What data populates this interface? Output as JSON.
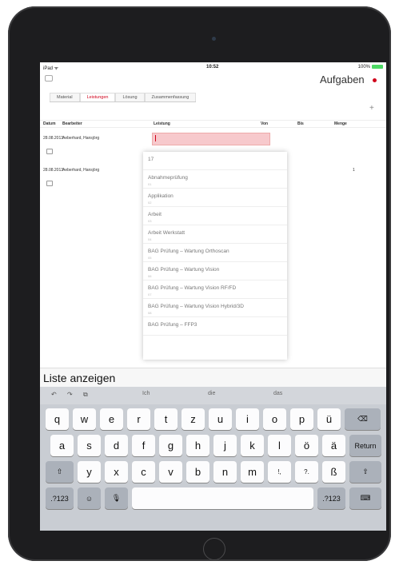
{
  "status": {
    "left": "iPad ᯤ",
    "time": "10:52",
    "battery": "100%"
  },
  "nav": {
    "title": "Aufgaben"
  },
  "tabs": [
    "Material",
    "Leistungen",
    "Lösung",
    "Zusammenfassung"
  ],
  "table": {
    "headers": [
      "Datum",
      "Bearbeiter",
      "Leistung",
      "Von",
      "Bis",
      "Menge"
    ],
    "rows": [
      {
        "date": "28.08.2013",
        "person": "Aeberhard, Hansjörg",
        "menge": ""
      },
      {
        "date": "28.08.2013",
        "person": "Aeberhard, Hansjörg",
        "menge": "1"
      }
    ]
  },
  "dropdown": {
    "items": [
      {
        "label": "17",
        "sub": ""
      },
      {
        "label": "Abnahmeprüfung",
        "sub": "01"
      },
      {
        "label": "Applikation",
        "sub": "02"
      },
      {
        "label": "Arbeit",
        "sub": "03"
      },
      {
        "label": "Arbeit Werkstatt",
        "sub": "04"
      },
      {
        "label": "BAG Prüfung – Wartung Orthoscan",
        "sub": "05"
      },
      {
        "label": "BAG Prüfung – Wartung Vision",
        "sub": "06"
      },
      {
        "label": "BAG Prüfung – Wartung Vision RF/FD",
        "sub": "07"
      },
      {
        "label": "BAG Prüfung – Wartung Vision Hybrid/3D",
        "sub": "08"
      },
      {
        "label": "BAG Prüfung – FFP3",
        "sub": ""
      }
    ]
  },
  "suggestion": "Liste anzeigen",
  "keyboard": {
    "tools": [
      "↶",
      "↷",
      "⧉"
    ],
    "predictions": [
      "Ich",
      "die",
      "das"
    ],
    "row1": [
      "q",
      "w",
      "e",
      "r",
      "t",
      "z",
      "u",
      "i",
      "o",
      "p",
      "ü"
    ],
    "row2": [
      "a",
      "s",
      "d",
      "f",
      "g",
      "h",
      "j",
      "k",
      "l",
      "ö",
      "ä"
    ],
    "row3": [
      "y",
      "x",
      "c",
      "v",
      "b",
      "n",
      "m",
      "!,",
      "?.",
      "ß"
    ],
    "delete": "⌫",
    "return": "Return",
    "shift": "⇧",
    "num": ".?123",
    "emoji": "☺",
    "mic": "🎙",
    "hide": "⌨"
  }
}
